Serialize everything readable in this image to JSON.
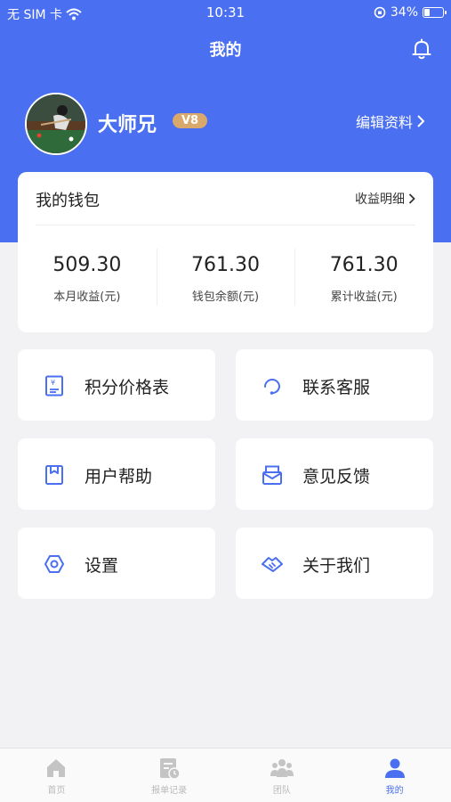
{
  "status_bar": {
    "carrier": "无 SIM 卡",
    "time": "10:31",
    "battery": "34%",
    "battery_level": 0.34
  },
  "header": {
    "title": "我的"
  },
  "profile": {
    "name": "大师兄",
    "vip": "V8",
    "edit_label": "编辑资料"
  },
  "wallet": {
    "title": "我的钱包",
    "detail_label": "收益明细",
    "stats": [
      {
        "value": "509.30",
        "label": "本月收益(元)"
      },
      {
        "value": "761.30",
        "label": "钱包余额(元)"
      },
      {
        "value": "761.30",
        "label": "累计收益(元)"
      }
    ]
  },
  "menu": [
    {
      "label": "积分价格表",
      "icon": "price-list-icon"
    },
    {
      "label": "联系客服",
      "icon": "customer-service-icon"
    },
    {
      "label": "用户帮助",
      "icon": "bookmark-icon"
    },
    {
      "label": "意见反馈",
      "icon": "envelope-icon"
    },
    {
      "label": "设置",
      "icon": "settings-icon"
    },
    {
      "label": "关于我们",
      "icon": "handshake-icon"
    }
  ],
  "tabs": [
    {
      "label": "首页",
      "icon": "home-icon",
      "active": false
    },
    {
      "label": "报单记录",
      "icon": "order-record-icon",
      "active": false
    },
    {
      "label": "团队",
      "icon": "team-icon",
      "active": false
    },
    {
      "label": "我的",
      "icon": "user-icon",
      "active": true
    }
  ],
  "colors": {
    "primary": "#4a6ff0",
    "vip": "#d9a96b",
    "background": "#f2f2f4",
    "tab_inactive": "#b9b9b9"
  }
}
